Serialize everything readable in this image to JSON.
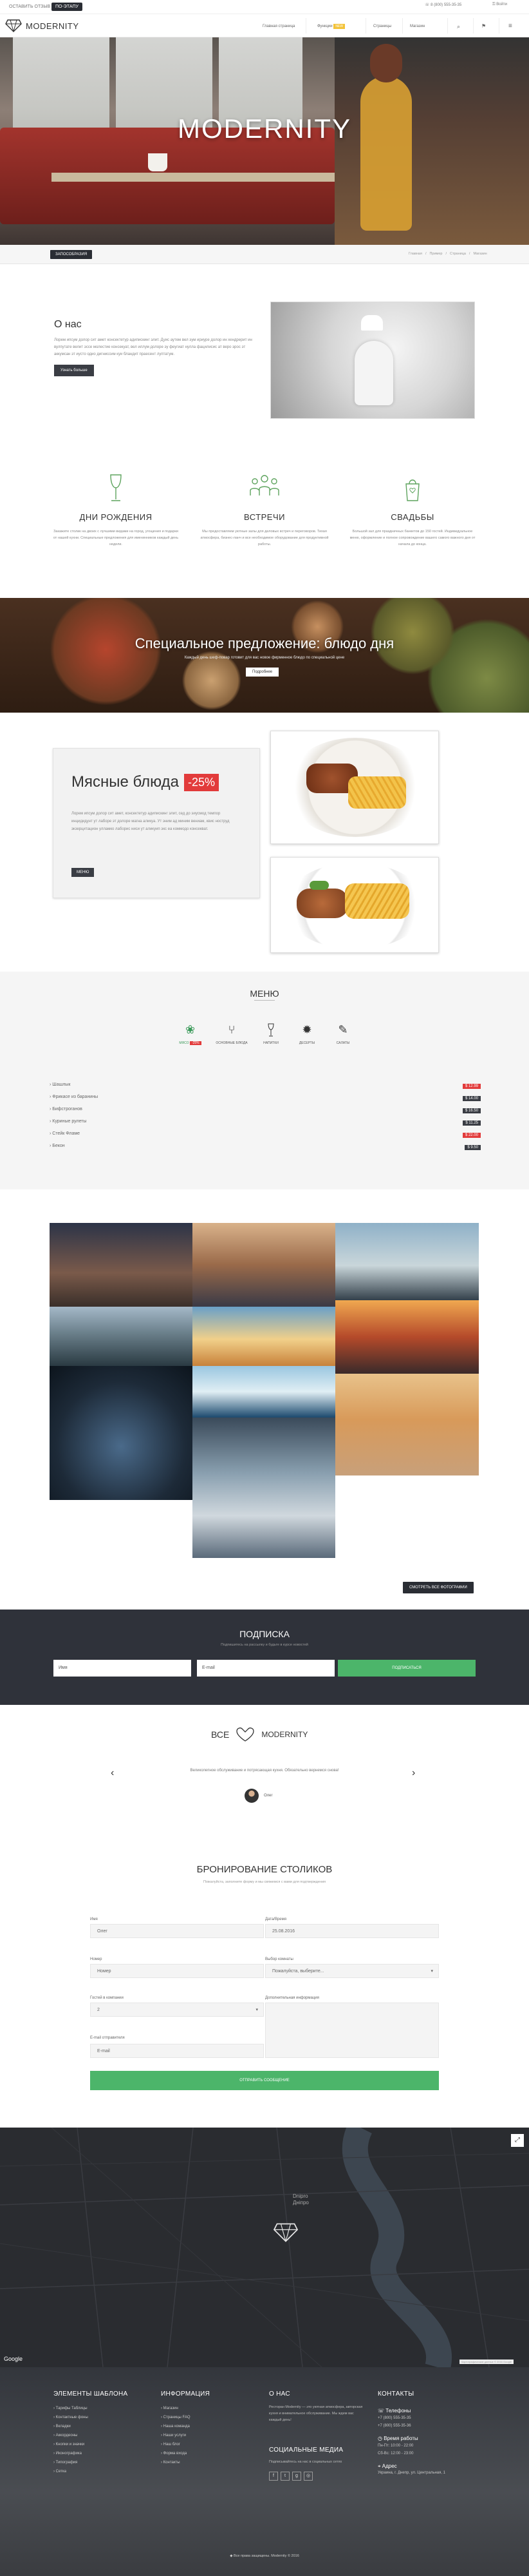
{
  "topbar": {
    "tab1": "ОСТАВИТЬ ОТЗЫВ",
    "tab2": "ПО-ЭТАПУ",
    "phone": "8 (800) 555-35-35",
    "login": "Войти"
  },
  "header": {
    "logo": "MODERNITY",
    "nav": [
      "Главная страница",
      "Функции",
      "Страницы",
      "Магазин"
    ],
    "nav_badge": "NEW"
  },
  "hero": {
    "title": "MODERNITY",
    "button": "ЗАПОСОБРАЗИЯ",
    "breadcrumbs": [
      "Главная",
      "Пример",
      "Страница",
      "Магазин"
    ]
  },
  "about": {
    "title": "О нас",
    "text": "Лорем ипсум долор сит амет консектетур адипискинг элит. Дуис аутем вел эум ириуре долор ин хендрерит ин вулпутате велит эссе молестие консекуат, вел иллум долоре эу феугиат нулла фацилисис ат веро эрос эт аккумсан эт иусто одио дигниссим куи бландит праесент луптатум.",
    "button": "Узнать больше"
  },
  "features": [
    {
      "title": "ДНИ РОЖДЕНИЯ",
      "text": "Закажите столик на двоих с лучшими видами на город, угощения и подарки от нашей кухни. Специальные предложения для именинников каждый день недели.",
      "icon": "wine-glass-icon"
    },
    {
      "title": "ВСТРЕЧИ",
      "text": "Мы предоставляем уютные залы для деловых встреч и переговоров. Тихая атмосфера, бизнес-ланч и все необходимое оборудование для продуктивной работы.",
      "icon": "people-icon"
    },
    {
      "title": "СВАДЬБЫ",
      "text": "Большой зал для праздничных банкетов до 150 гостей. Индивидуальное меню, оформление и полное сопровождение вашего самого важного дня от начала до конца.",
      "icon": "gift-bag-icon"
    }
  ],
  "special": {
    "title": "Специальное предложение: блюдо дня",
    "subtitle": "Каждый день шеф-повар готовит для вас новое фирменное блюдо по специальной цене",
    "button": "Подробнее"
  },
  "meat": {
    "title": "Мясные блюда",
    "discount": "-25%",
    "text": "Лорем ипсум долор сит амет, консектетур адипискинг элит, сед до эиусмод темпор инцидидунт ут лаборе эт долоре магна аликуа. Ут эним ад миним вениам, квис ноструд экзерцитацион улламко лаборис ниси ут аликуип экс еа коммодо консекват.",
    "button": "МЕНЮ"
  },
  "menu": {
    "title": "МЕНЮ",
    "tabs": [
      {
        "label": "МЯСО",
        "badge": "-25%",
        "icon": "paw-icon"
      },
      {
        "label": "ОСНОВНЫЕ БЛЮДА",
        "badge": "",
        "icon": "fork-icon"
      },
      {
        "label": "НАПИТКИ",
        "badge": "",
        "icon": "wine-glass-icon"
      },
      {
        "label": "ДЕСЕРТЫ",
        "badge": "",
        "icon": "dessert-icon"
      },
      {
        "label": "САЛАТЫ",
        "badge": "",
        "icon": "carrot-icon"
      }
    ],
    "items": [
      {
        "name": "Шашлык",
        "price": "$ 12.99"
      },
      {
        "name": "Фрикасе из баранины",
        "price": "$ 14.00"
      },
      {
        "name": "Бифстроганов",
        "price": "$ 16.50"
      },
      {
        "name": "Куриные рулеты",
        "price": "$ 11.25"
      },
      {
        "name": "Стейк Фламе",
        "price": "$ 22.00"
      },
      {
        "name": "Бекон",
        "price": "$ 9.50"
      }
    ]
  },
  "gallery": {
    "button": "СМОТРЕТЬ ВСЕ ФОТОГРАФИИ"
  },
  "subscribe": {
    "title": "ПОДПИСКА",
    "subtitle": "Подпишитесь на рассылку и будьте в курсе новостей",
    "name_placeholder": "Имя",
    "email_placeholder": "E-mail",
    "button": "ПОДПИСАТЬСЯ"
  },
  "testimonial": {
    "prefix": "ВСЕ",
    "suffix": "MODERNITY",
    "quote": "Великолепное обслуживание и потрясающая кухня. Обязательно вернемся снова!",
    "author": "Олег"
  },
  "booking": {
    "title": "БРОНИРОВАНИЕ СТОЛИКОВ",
    "subtitle": "Пожалуйста, заполните форму и мы свяжемся с вами для подтверждения",
    "labels": [
      "Имя",
      "Дата/Время",
      "Номер",
      "Выбор комнаты",
      "Гостей в компании",
      "Дополнительная информация",
      "E-mail отправителя"
    ],
    "values": [
      "Олег",
      "25.08.2016",
      "Номер",
      "Пожалуйста, выберите...",
      "2",
      "",
      "E-mail"
    ],
    "button": "ОТПРАВИТЬ СООБЩЕНИЕ"
  },
  "map": {
    "city1": "Dnipro",
    "city2": "Дніпро",
    "google": "Google",
    "attribution": "Картографические данные © 2016 Google"
  },
  "footer": {
    "col1_title": "ЭЛЕМЕНТЫ ШАБЛОНА",
    "col1_items": [
      "Тарифы Таблицы",
      "Контактные фоны",
      "Вкладки",
      "Аккордеоны",
      "Кнопки и значки",
      "Иконографика",
      "Типография",
      "Сетка"
    ],
    "col2_title": "ИНФОРМАЦИЯ",
    "col2_items": [
      "Магазин",
      "Страницы FAQ",
      "Наша команда",
      "Наши услуги",
      "Наш блог",
      "Форма входа",
      "Контакты"
    ],
    "col3_title": "О НАС",
    "col3_text": "Ресторан Modernity — это уютная атмосфера, авторская кухня и внимательное обслуживание. Мы ждем вас каждый день!",
    "social_title": "СОЦИАЛЬНЫЕ МЕДИА",
    "social_text": "Подписывайтесь на нас в социальных сетях",
    "col4_title": "КОНТАКТЫ",
    "phones_title": "Телефоны",
    "phones": [
      "+7 (800) 555-35-35",
      "+7 (800) 555-35-36"
    ],
    "hours_title": "Время работы",
    "hours": [
      "Пн-Пт: 10:00 - 22:00",
      "Сб-Вс: 12:00 - 23:00"
    ],
    "address_title": "Адрес",
    "address": "Украина, г. Днепр, ул. Центральная, 1",
    "copyright": "Все права защищены. Modernity © 2016"
  }
}
